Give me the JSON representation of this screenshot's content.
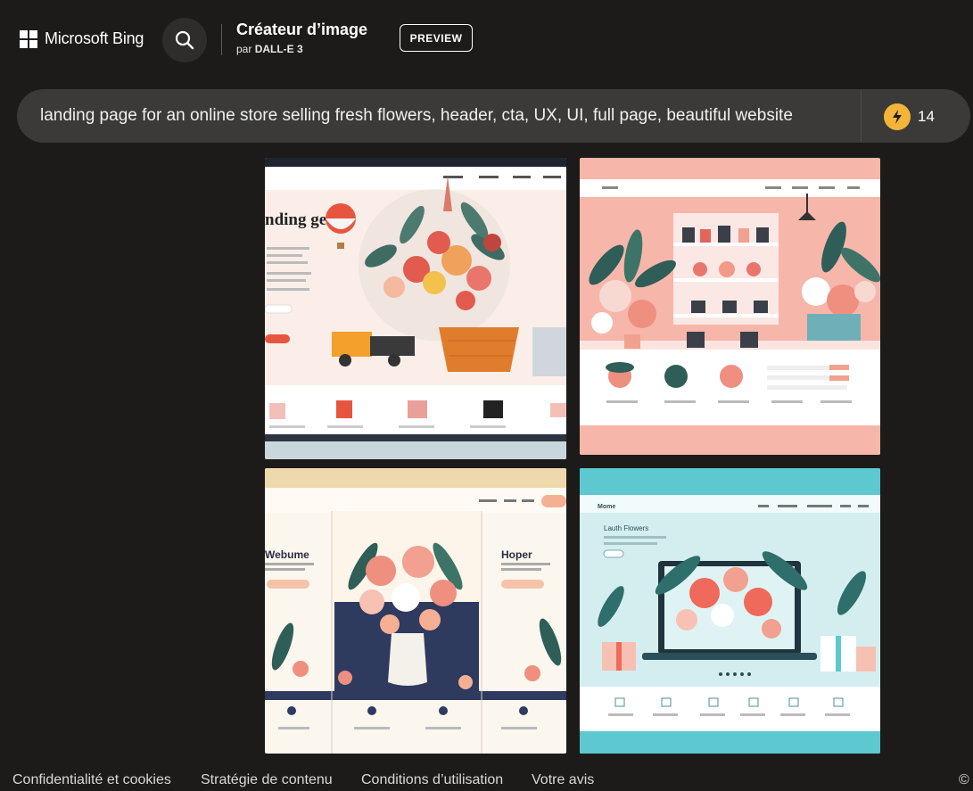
{
  "header": {
    "logo_text": "Microsoft Bing",
    "title": "Créateur d’image",
    "subtitle_prefix": "par",
    "subtitle_model": "DALL-E 3",
    "preview_label": "PREVIEW"
  },
  "prompt": {
    "text": "landing page for an online store selling fresh flowers, header, cta, UX, UI, full page, beautiful website",
    "boost_count": "14"
  },
  "images": [
    {
      "heading": "nding ge"
    },
    {
      "heading": ""
    },
    {
      "heading_left": "Webume",
      "heading_right": "Hoper"
    },
    {
      "heading": "Lauth Flowers",
      "nav_brand": "Mome"
    }
  ],
  "footer": {
    "links": [
      "Confidentialité et cookies",
      "Stratégie de contenu",
      "Conditions d’utilisation",
      "Votre avis"
    ],
    "copyright": "©"
  }
}
